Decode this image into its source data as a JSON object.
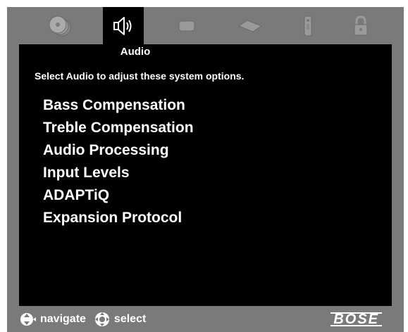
{
  "header": {
    "active_tab_label": "Audio"
  },
  "tabs": [
    {
      "icon": "disc-icon",
      "active": false
    },
    {
      "icon": "speaker-icon",
      "active": true
    },
    {
      "icon": "display-icon",
      "active": false
    },
    {
      "icon": "remote-flat-icon",
      "active": false
    },
    {
      "icon": "remote-icon",
      "active": false
    },
    {
      "icon": "lock-icon",
      "active": false
    }
  ],
  "main": {
    "subtitle": "Select Audio to adjust these system options.",
    "menu": [
      "Bass Compensation",
      "Treble Compensation",
      "Audio Processing",
      "Input Levels",
      "ADAPTiQ",
      "Expansion Protocol"
    ]
  },
  "footer": {
    "navigate_label": "navigate",
    "select_label": "select",
    "brand": "BOSE"
  },
  "colors": {
    "panel": "#7a7a7a",
    "screen": "#000000",
    "text": "#ffffff",
    "inactive_icon": "#9a9a9a"
  }
}
